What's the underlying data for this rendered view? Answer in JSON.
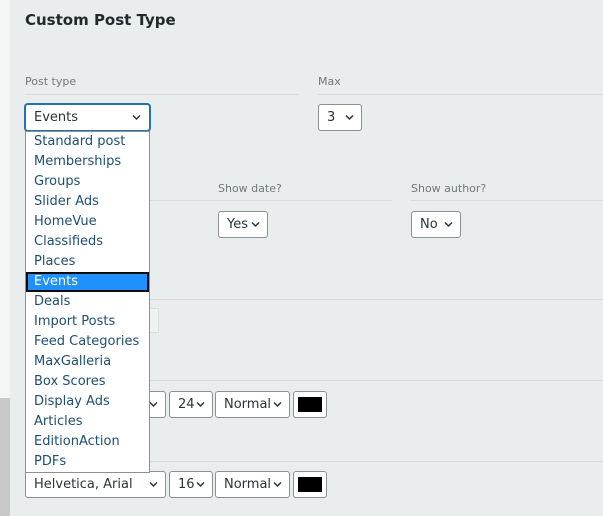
{
  "title": "Custom Post Type",
  "fields": {
    "post_type_label": "Post type",
    "max_label": "Max",
    "show_date_label": "Show date?",
    "show_author_label": "Show author?"
  },
  "selects": {
    "post_type": "Events",
    "max": "3",
    "show_date": "Yes",
    "show_author": "No",
    "font_size_1": "24",
    "font_weight_1": "Normal",
    "font_family_2": "Helvetica, Arial",
    "font_size_2": "16",
    "font_weight_2": "Normal"
  },
  "colors": {
    "swatch_1": "#000000",
    "swatch_2": "#000000",
    "selected_option": "#1e90ff"
  },
  "dropdown": {
    "options": [
      "Standard post",
      "Memberships",
      "Groups",
      "Slider Ads",
      "HomeVue",
      "Classifieds",
      "Places",
      "Events",
      "Deals",
      "Import Posts",
      "Feed Categories",
      "MaxGalleria",
      "Box Scores",
      "Display Ads",
      "Articles",
      "EditionAction",
      "PDFs"
    ],
    "selected": "Events"
  },
  "icons": {
    "select_arrow": "chevron-down-icon"
  }
}
